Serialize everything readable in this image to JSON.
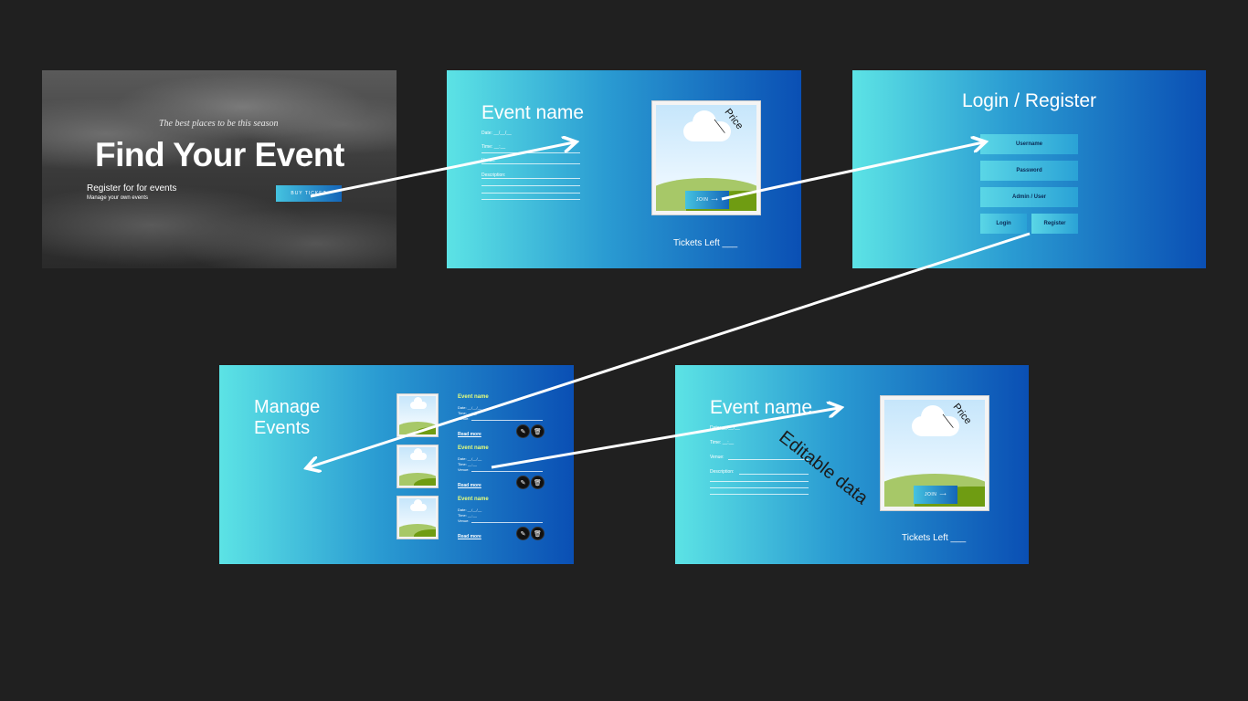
{
  "hero": {
    "tagline": "The best places to be this season",
    "title": "Find Your Event",
    "subtitle": "Register for for events",
    "subtitle2": "Manage your own events",
    "buy_button": "BUY TICKET"
  },
  "event_detail": {
    "title": "Event name",
    "date": "Date: __/__/__",
    "time": "Time: __:__",
    "venue": "Venue:",
    "description": "Description:",
    "price": "Price ___",
    "join_button": "JOIN",
    "tickets_left": "Tickets Left ___"
  },
  "login": {
    "title": "Login / Register",
    "username": "Username",
    "password": "Password",
    "role": "Admin / User",
    "login_button": "Login",
    "register_button": "Register"
  },
  "manage": {
    "title_line1": "Manage",
    "title_line2": "Events",
    "items": [
      {
        "name": "Event name",
        "date": "Date: __/__/__",
        "time": "Time: __:__",
        "venue": "Venue:",
        "read_more": "Read more"
      },
      {
        "name": "Event name",
        "date": "Date: __/__/__",
        "time": "Time: __:__",
        "venue": "Venue:",
        "read_more": "Read more"
      },
      {
        "name": "Event name",
        "date": "Date: __/__/__",
        "time": "Time: __:__",
        "venue": "Venue:",
        "read_more": "Read more"
      }
    ]
  },
  "edit_event": {
    "title": "Event name",
    "date": "Date: __/__/__",
    "time": "Time: __:__",
    "venue": "Venue:",
    "description": "Description:",
    "price": "Price ___",
    "join_button": "JOIN",
    "tickets_left": "Tickets Left ___",
    "annotation": "Editable data"
  },
  "icons": {
    "edit": "edit-icon",
    "delete": "trash-icon",
    "arrow": "arrow-right-icon"
  },
  "colors": {
    "background": "#202020",
    "gradient_start": "#5ce3e5",
    "gradient_end": "#0a4fb4",
    "flow_arrow": "#ffffff"
  }
}
